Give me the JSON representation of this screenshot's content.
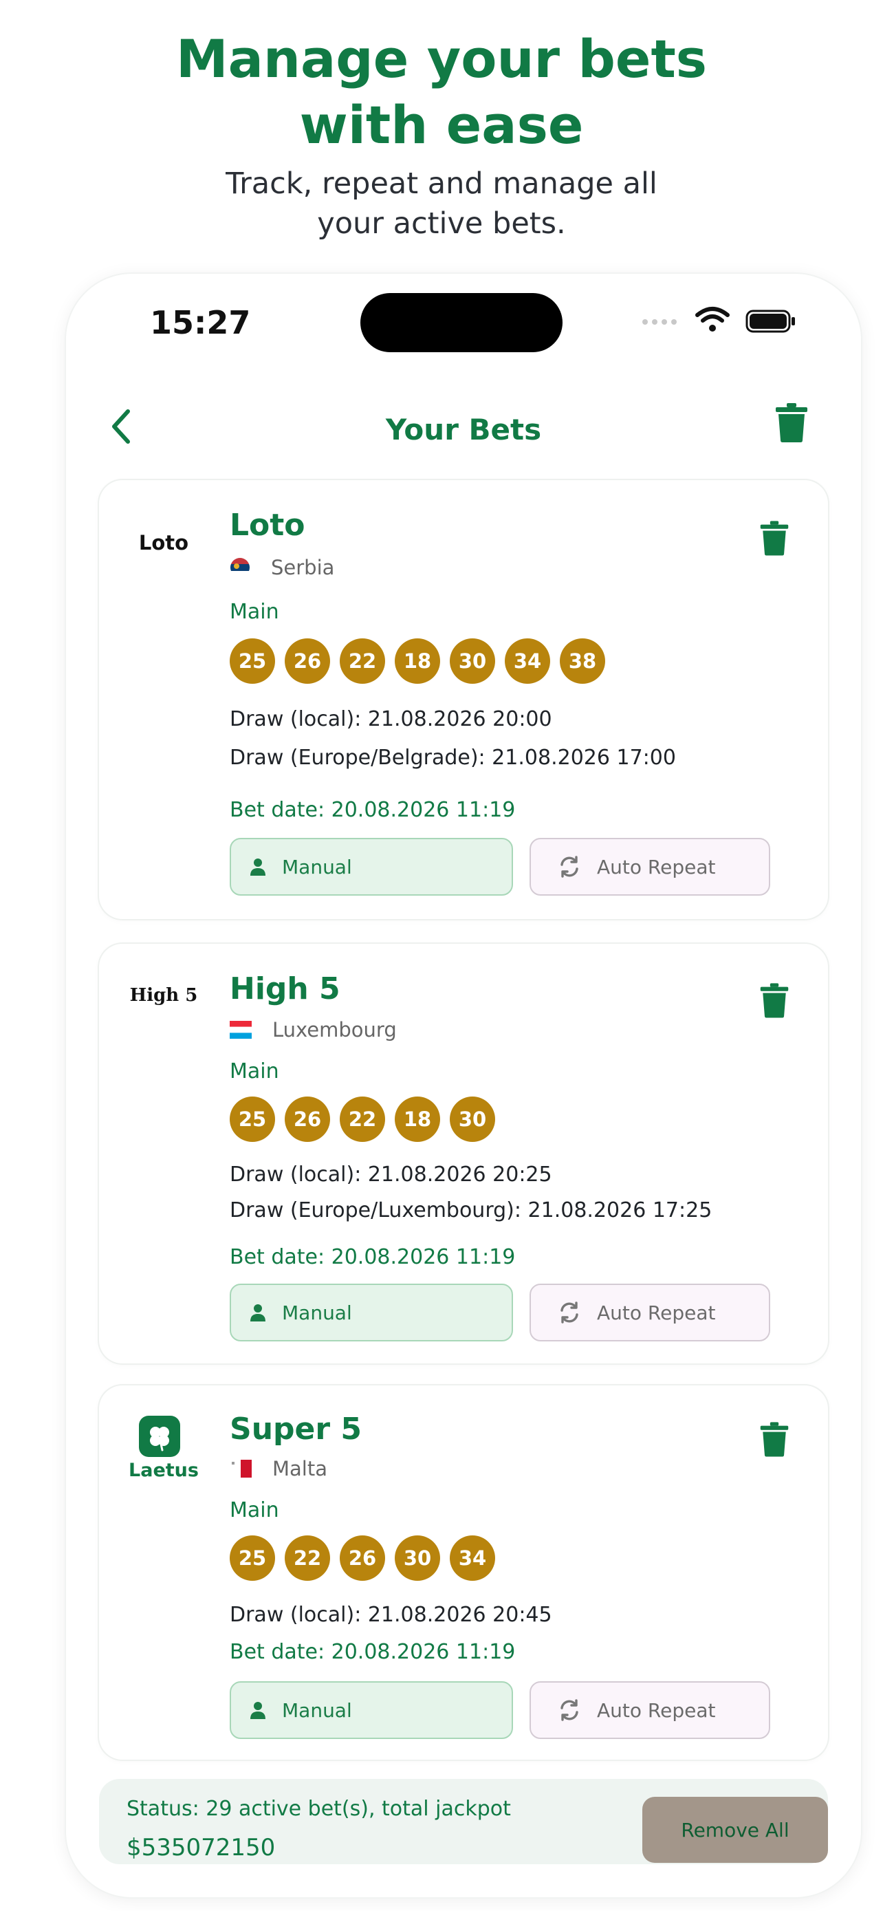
{
  "hero": {
    "title_line1": "Manage your bets",
    "title_line2": "with ease",
    "subtitle_line1": "Track, repeat and manage all",
    "subtitle_line2": "your active bets."
  },
  "status_bar": {
    "time": "15:27"
  },
  "nav": {
    "title": "Your Bets"
  },
  "colors": {
    "accent": "#117a45",
    "ball": "#b8840d",
    "manual_bg": "#e5f4ea",
    "auto_bg": "#fbf5fb"
  },
  "bets": [
    {
      "logo_text": "Loto",
      "name": "Loto",
      "country": "Serbia",
      "flag_icon": "serbia-flag-icon",
      "main_label": "Main",
      "numbers": [
        "25",
        "26",
        "22",
        "18",
        "30",
        "34",
        "38"
      ],
      "draws": [
        "Draw (local): 21.08.2026 20:00",
        "Draw (Europe/Belgrade): 21.08.2026 17:00"
      ],
      "bet_date": "Bet date: 20.08.2026 11:19",
      "manual_label": "Manual",
      "auto_label": "Auto Repeat"
    },
    {
      "logo_text": "High 5",
      "name": "High 5",
      "country": "Luxembourg",
      "flag_icon": "luxembourg-flag-icon",
      "main_label": "Main",
      "numbers": [
        "25",
        "26",
        "22",
        "18",
        "30"
      ],
      "draws": [
        "Draw (local): 21.08.2026 20:25",
        "Draw (Europe/Luxembourg): 21.08.2026 17:25"
      ],
      "bet_date": "Bet date: 20.08.2026 11:19",
      "manual_label": "Manual",
      "auto_label": "Auto Repeat"
    },
    {
      "logo_text": "Laetus",
      "name": "Super 5",
      "country": "Malta",
      "flag_icon": "malta-flag-icon",
      "main_label": "Main",
      "numbers": [
        "25",
        "22",
        "26",
        "30",
        "34"
      ],
      "draws": [
        "Draw (local): 21.08.2026 20:45"
      ],
      "bet_date": "Bet date: 20.08.2026 11:19",
      "manual_label": "Manual",
      "auto_label": "Auto Repeat"
    }
  ],
  "status": {
    "line1": "Status: 29 active bet(s), total jackpot",
    "line2": "$535072150",
    "remove_all": "Remove All"
  }
}
